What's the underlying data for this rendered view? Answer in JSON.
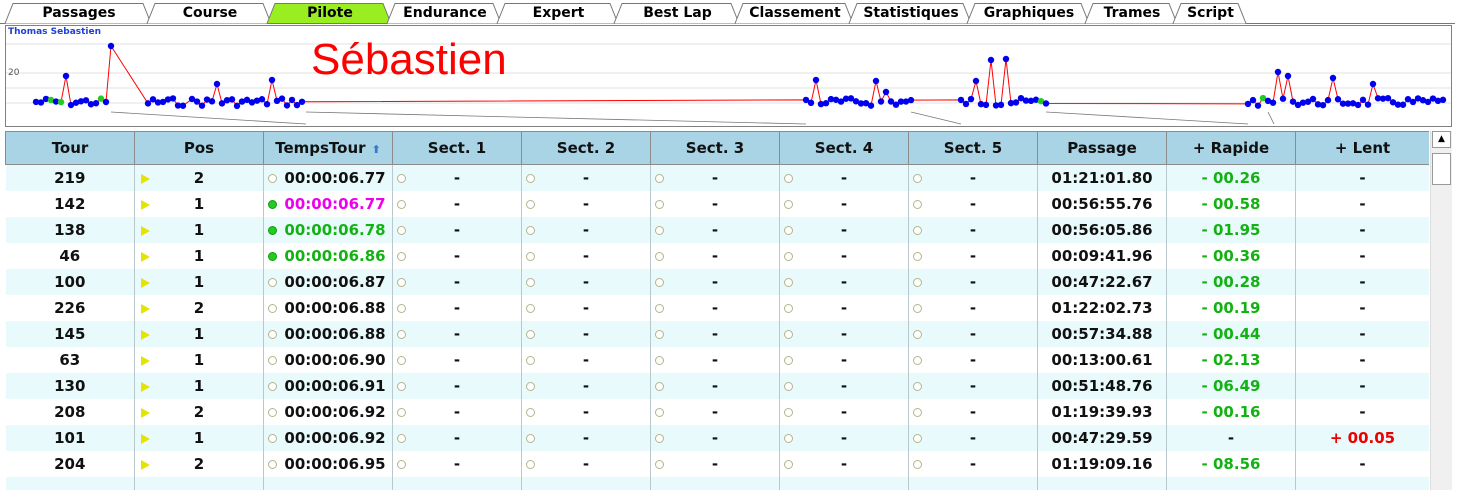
{
  "tabs": [
    {
      "label": "Passages"
    },
    {
      "label": "Course"
    },
    {
      "label": "Pilote",
      "active": true
    },
    {
      "label": "Endurance"
    },
    {
      "label": "Expert"
    },
    {
      "label": "Best Lap"
    },
    {
      "label": "Classement"
    },
    {
      "label": "Statistiques"
    },
    {
      "label": "Graphiques"
    },
    {
      "label": "Trames"
    },
    {
      "label": "Script"
    }
  ],
  "chart": {
    "title": "Thomas Sebastien",
    "driver_name": "Sébastien",
    "y_tick": "20"
  },
  "chart_data": {
    "type": "line",
    "title": "Thomas Sebastien",
    "y_tick_labels": [
      "20"
    ],
    "series_color": "#ff0000",
    "point_color": "#0000ee",
    "best_point_color": "#22cc22"
  },
  "table": {
    "headers": [
      "Tour",
      "Pos",
      "TempsTour",
      "Sect. 1",
      "Sect. 2",
      "Sect. 3",
      "Sect. 4",
      "Sect. 5",
      "Passage",
      "+ Rapide",
      "+ Lent"
    ],
    "sort_icon": "sort-up-arrow-icon",
    "rows": [
      {
        "tour": "219",
        "pos": "2",
        "temps": "00:00:06.77",
        "temps_color": "#111111",
        "dot": "empty",
        "s1": "-",
        "s2": "-",
        "s3": "-",
        "s4": "-",
        "s5": "-",
        "passage": "01:21:01.80",
        "rapide": "- 00.26",
        "lent": "-"
      },
      {
        "tour": "142",
        "pos": "1",
        "temps": "00:00:06.77",
        "temps_color": "#ee00ee",
        "dot": "green",
        "s1": "-",
        "s2": "-",
        "s3": "-",
        "s4": "-",
        "s5": "-",
        "passage": "00:56:55.76",
        "rapide": "- 00.58",
        "lent": "-"
      },
      {
        "tour": "138",
        "pos": "1",
        "temps": "00:00:06.78",
        "temps_color": "#13b213",
        "dot": "green",
        "s1": "-",
        "s2": "-",
        "s3": "-",
        "s4": "-",
        "s5": "-",
        "passage": "00:56:05.86",
        "rapide": "- 01.95",
        "lent": "-"
      },
      {
        "tour": "46",
        "pos": "1",
        "temps": "00:00:06.86",
        "temps_color": "#13b213",
        "dot": "green",
        "s1": "-",
        "s2": "-",
        "s3": "-",
        "s4": "-",
        "s5": "-",
        "passage": "00:09:41.96",
        "rapide": "- 00.36",
        "lent": "-"
      },
      {
        "tour": "100",
        "pos": "1",
        "temps": "00:00:06.87",
        "temps_color": "#111111",
        "dot": "empty",
        "s1": "-",
        "s2": "-",
        "s3": "-",
        "s4": "-",
        "s5": "-",
        "passage": "00:47:22.67",
        "rapide": "- 00.28",
        "lent": "-"
      },
      {
        "tour": "226",
        "pos": "2",
        "temps": "00:00:06.88",
        "temps_color": "#111111",
        "dot": "empty",
        "s1": "-",
        "s2": "-",
        "s3": "-",
        "s4": "-",
        "s5": "-",
        "passage": "01:22:02.73",
        "rapide": "- 00.19",
        "lent": "-"
      },
      {
        "tour": "145",
        "pos": "1",
        "temps": "00:00:06.88",
        "temps_color": "#111111",
        "dot": "empty",
        "s1": "-",
        "s2": "-",
        "s3": "-",
        "s4": "-",
        "s5": "-",
        "passage": "00:57:34.88",
        "rapide": "- 00.44",
        "lent": "-"
      },
      {
        "tour": "63",
        "pos": "1",
        "temps": "00:00:06.90",
        "temps_color": "#111111",
        "dot": "empty",
        "s1": "-",
        "s2": "-",
        "s3": "-",
        "s4": "-",
        "s5": "-",
        "passage": "00:13:00.61",
        "rapide": "- 02.13",
        "lent": "-"
      },
      {
        "tour": "130",
        "pos": "1",
        "temps": "00:00:06.91",
        "temps_color": "#111111",
        "dot": "empty",
        "s1": "-",
        "s2": "-",
        "s3": "-",
        "s4": "-",
        "s5": "-",
        "passage": "00:51:48.76",
        "rapide": "- 06.49",
        "lent": "-"
      },
      {
        "tour": "208",
        "pos": "2",
        "temps": "00:00:06.92",
        "temps_color": "#111111",
        "dot": "empty",
        "s1": "-",
        "s2": "-",
        "s3": "-",
        "s4": "-",
        "s5": "-",
        "passage": "01:19:39.93",
        "rapide": "- 00.16",
        "lent": "-"
      },
      {
        "tour": "101",
        "pos": "1",
        "temps": "00:00:06.92",
        "temps_color": "#111111",
        "dot": "empty",
        "s1": "-",
        "s2": "-",
        "s3": "-",
        "s4": "-",
        "s5": "-",
        "passage": "00:47:29.59",
        "rapide": "-",
        "lent": "+ 00.05"
      },
      {
        "tour": "204",
        "pos": "2",
        "temps": "00:00:06.95",
        "temps_color": "#111111",
        "dot": "empty",
        "s1": "-",
        "s2": "-",
        "s3": "-",
        "s4": "-",
        "s5": "-",
        "passage": "01:19:09.16",
        "rapide": "- 08.56",
        "lent": "-"
      },
      {
        "tour": "",
        "pos": "",
        "temps": "",
        "temps_color": "#111111",
        "dot": "empty",
        "s1": "",
        "s2": "",
        "s3": "",
        "s4": "",
        "s5": "",
        "passage": "",
        "rapide": "",
        "lent": ""
      }
    ]
  },
  "colors": {
    "header_bg": "#a8d4e6",
    "row_alt_bg": "#e8fafb",
    "active_tab": "#99ee22",
    "rapide_text": "#13b213",
    "lent_text": "#ee0000",
    "pos_marker": "#e4e400"
  },
  "scrollbar": {
    "up_icon": "scroll-up-arrow-icon"
  }
}
